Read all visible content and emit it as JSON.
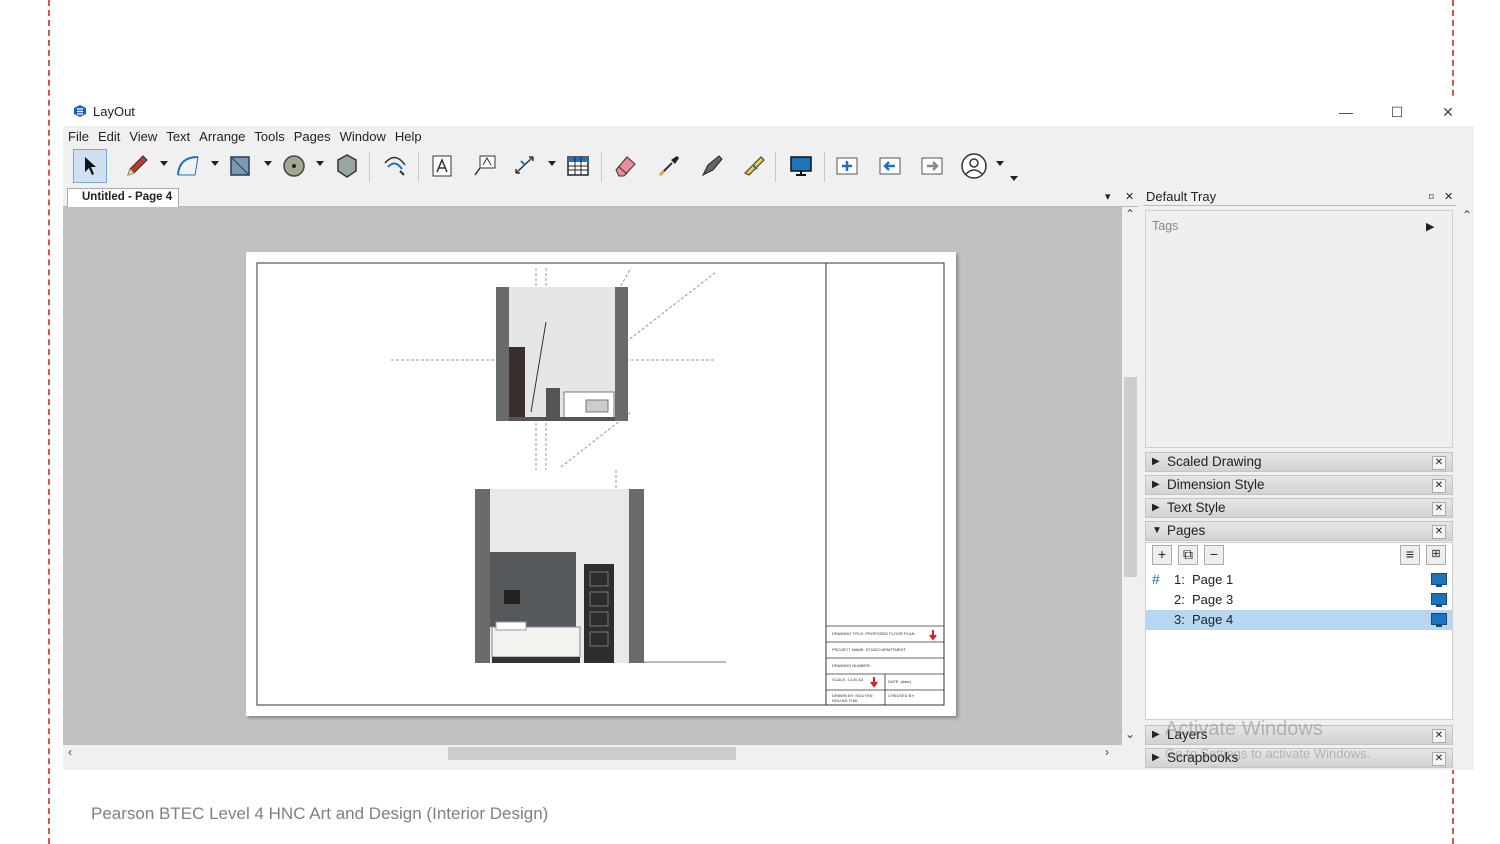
{
  "window": {
    "app_title": "LayOut",
    "minimize": "—",
    "maximize": "☐",
    "close": "✕"
  },
  "menu": [
    "File",
    "Edit",
    "View",
    "Text",
    "Arrange",
    "Tools",
    "Pages",
    "Window",
    "Help"
  ],
  "toolbar": {
    "tools": [
      "select-tool",
      "pencil-tool",
      "arc-tool",
      "rectangle-tool",
      "circle-tool",
      "polygon-tool",
      "offset-tool",
      "text-tool",
      "label-tool",
      "dimension-tool",
      "table-tool",
      "eraser-tool",
      "sample-tool",
      "split-tool",
      "join-tool",
      "presentation-tool",
      "add-page-tool",
      "previous-page-tool",
      "next-page-tool",
      "account-tool"
    ]
  },
  "document": {
    "tab_label": "Untitled - Page 4",
    "tab_menu": "▾",
    "tab_close": "✕"
  },
  "titleblock": {
    "drawing_title": "DRAWING TITLE: PROPOSED FLOOR PLAN",
    "project_name": "PROJECT NAME: STUDIO APARTMENT",
    "drawing_number": "DRAWING NUMBER:",
    "scale": "SCALE: 1:100 A3",
    "date": "DATE: (date)",
    "drawn_by": "DRAWN BY: NGUYEN NGU AN THAI",
    "checked_by": "CHECKED BY:"
  },
  "tray": {
    "title": "Default Tray",
    "pin": "⌑",
    "close": "✕",
    "tags_label": "Tags",
    "panels": {
      "scaled_drawing": "Scaled Drawing",
      "dimension_style": "Dimension Style",
      "text_style": "Text Style",
      "pages": "Pages",
      "layers": "Layers",
      "scrapbooks": "Scrapbooks"
    },
    "pages": [
      {
        "num": "1:",
        "name": "Page 1",
        "selected": false
      },
      {
        "num": "2:",
        "name": "Page 3",
        "selected": false
      },
      {
        "num": "3:",
        "name": "Page 4",
        "selected": true
      }
    ],
    "pages_buttons": {
      "add": "+",
      "duplicate": "⧉",
      "remove": "−"
    }
  },
  "watermark": {
    "line1": "Activate Windows",
    "line2": "Go to Settings to activate Windows."
  },
  "footer": "Pearson BTEC Level 4 HNC Art and Design (Interior Design)",
  "colors": {
    "canvas": "#c0c0c0",
    "accent": "#1e73be",
    "selection": "#b7d7f0",
    "margin_guide": "#d9534f",
    "warning_arrow": "#e02020"
  }
}
